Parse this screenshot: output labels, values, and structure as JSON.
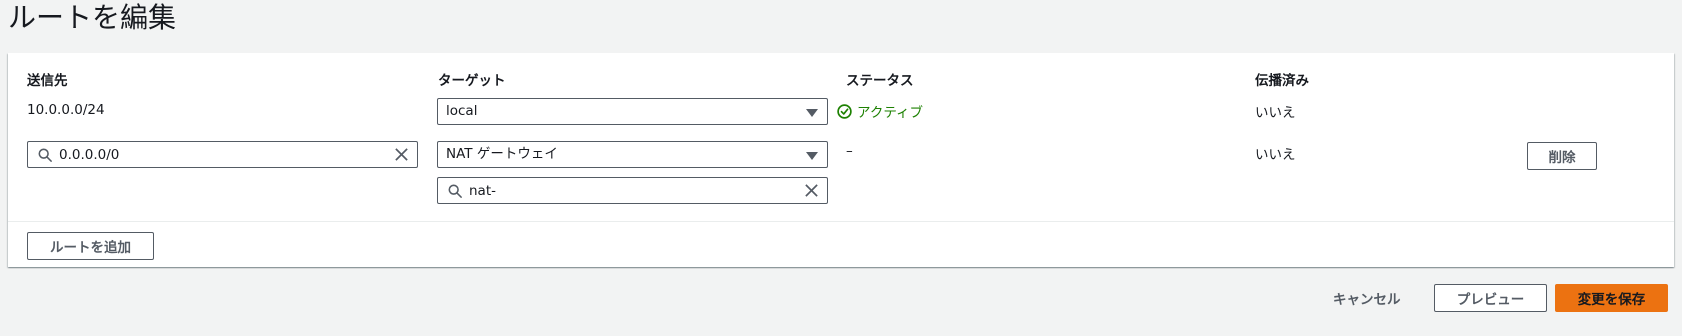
{
  "page": {
    "title": "ルートを編集"
  },
  "table": {
    "headers": {
      "destination": "送信先",
      "target": "ターゲット",
      "status": "ステータス",
      "propagated": "伝播済み"
    },
    "rows": [
      {
        "destination": "10.0.0.0/24",
        "target": "local",
        "status": "アクティブ",
        "propagated": "いいえ"
      },
      {
        "destination": "0.0.0.0/0",
        "target": "NAT ゲートウェイ",
        "target_search": "nat-",
        "status": "–",
        "propagated": "いいえ",
        "remove_label": "削除"
      }
    ]
  },
  "actions": {
    "add_route": "ルートを追加",
    "cancel": "キャンセル",
    "preview": "プレビュー",
    "save": "変更を保存"
  },
  "colors": {
    "status_active": "#1d8102",
    "primary": "#ec7211"
  }
}
